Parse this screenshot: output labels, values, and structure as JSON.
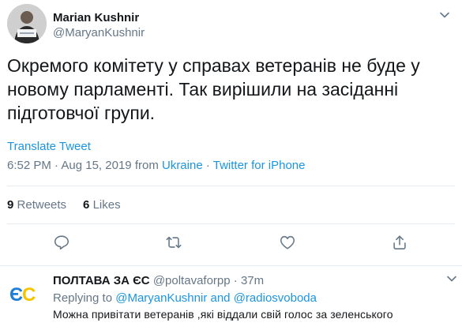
{
  "tweet": {
    "display_name": "Marian Kushnir",
    "handle": "@MaryanKushnir",
    "text": "Окремого комітету у справах ветеранів не буде у новому парламенті. Так вирішили на засіданні підготовчої групи.",
    "translate_label": "Translate Tweet",
    "time": "6:52 PM",
    "date": "Aug 15, 2019",
    "from_label": "from",
    "location": "Ukraine",
    "dot": "·",
    "source": "Twitter for iPhone",
    "retweets_count": "9",
    "retweets_label": "Retweets",
    "likes_count": "6",
    "likes_label": "Likes"
  },
  "icons": {
    "reply": "reply-icon",
    "retweet": "retweet-icon",
    "like": "heart-icon",
    "share": "share-icon",
    "caret": "chevron-down-icon"
  },
  "reply": {
    "display_name": "ПОЛТАВА ЗА ЄС",
    "handle": "@poltavaforpp",
    "dot": "·",
    "time": "37m",
    "replying_prefix": "Replying to",
    "mention_1": "@MaryanKushnir",
    "and_label": "and",
    "mention_2": "@radiosvoboda",
    "text": "Можна привітати ветеранів ,які віддали свій голос за зеленського",
    "logo_text": "ЄС"
  },
  "colors": {
    "text_primary": "#14171a",
    "text_secondary": "#657786",
    "link": "#1b95e0",
    "divider": "#e6ecf0",
    "logo_blue": "#1e7fd8",
    "logo_yellow": "#f5c400"
  }
}
